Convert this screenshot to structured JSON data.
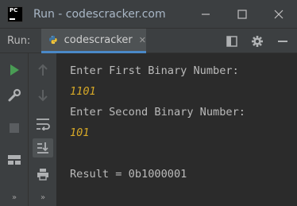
{
  "window": {
    "title": "Run - codescracker.com",
    "app_icon_text": "PC"
  },
  "toolbar": {
    "run_label": "Run:",
    "tab_label": "codescracker"
  },
  "console": {
    "lines": [
      {
        "text": "Enter First Binary Number:",
        "kind": "output"
      },
      {
        "text": "1101",
        "kind": "input"
      },
      {
        "text": "Enter Second Binary Number:",
        "kind": "output"
      },
      {
        "text": "101",
        "kind": "input"
      },
      {
        "text": "",
        "kind": "output"
      },
      {
        "text": "Result = 0b1000001",
        "kind": "output"
      }
    ]
  },
  "sidebar": {
    "more_left": "»",
    "more_right": "»"
  },
  "colors": {
    "background": "#2b2b2b",
    "panel": "#3c3f41",
    "output_text": "#bbbbbb",
    "input_text": "#d6a827",
    "run_green": "#499c54",
    "tab_underline": "#4a88c7"
  },
  "icons": [
    "pycharm-logo-icon",
    "minimize-icon",
    "maximize-icon",
    "close-icon",
    "python-icon",
    "layout-icon",
    "gear-icon",
    "minus-icon",
    "run-icon",
    "up-arrow-icon",
    "wrench-icon",
    "down-arrow-icon",
    "stop-icon",
    "soft-wrap-icon",
    "scroll-to-end-icon",
    "layout-grid-icon",
    "print-icon"
  ]
}
